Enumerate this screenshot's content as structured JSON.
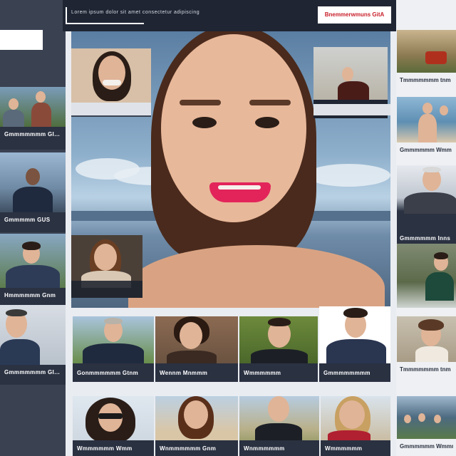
{
  "header": {
    "title": "Lorem ipsum dolor sit amet consectetur adipiscing",
    "cta_label": "Bnemmerwmuns GitA"
  },
  "left_cards": [
    {
      "caption": "Gmmmmmmm GIOA"
    },
    {
      "caption": "Gmmmmm GUS"
    },
    {
      "caption": "Hmmmmmm Gnm"
    },
    {
      "caption": "Gmmmmmmm GIOA"
    }
  ],
  "right_cards": [
    {
      "caption": "Tmmmmmmm tnm"
    },
    {
      "caption": "Gmmmmmm Wmm"
    },
    {
      "caption": "Gmmmmmm Inns"
    },
    {
      "caption": "Tmmmmmmm tnm"
    },
    {
      "caption": "Gmmmmmm Wmmm"
    }
  ],
  "hero_insets": [
    {
      "caption": ""
    },
    {
      "caption": ""
    },
    {
      "caption": ""
    }
  ],
  "grid_tiles": [
    {
      "caption": "Gonmmmmmm Gtnm"
    },
    {
      "caption": "Wennm Mnmmm"
    },
    {
      "caption": "Wmmmmmm"
    },
    {
      "caption": "Gmmmmmmmm"
    },
    {
      "caption": "Wmmmmmm Wmm"
    },
    {
      "caption": "Wnmmmmmm Gnm"
    },
    {
      "caption": "Wnmmmmmm"
    },
    {
      "caption": "Wmmmmmm"
    }
  ],
  "colors": {
    "dark_panel": "#2c3444",
    "accent_red": "#c8202a",
    "background": "#e9ecf1"
  }
}
